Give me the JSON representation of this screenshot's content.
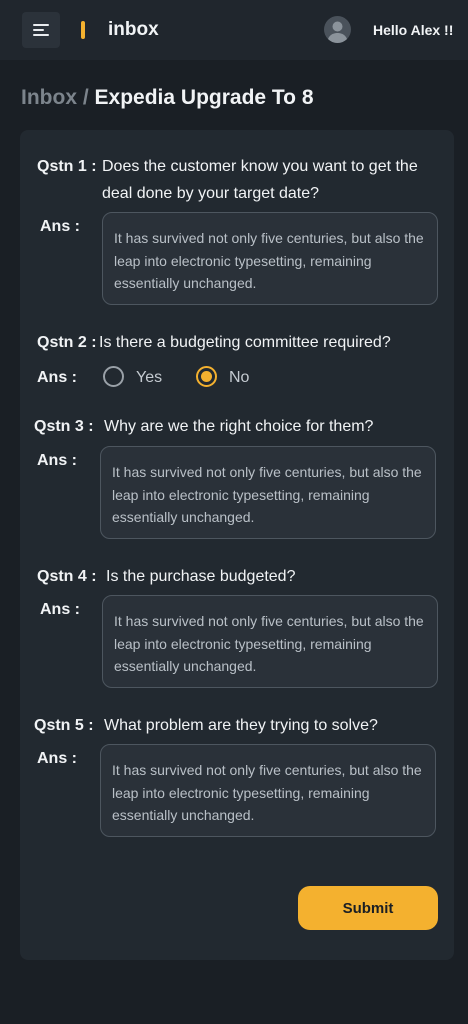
{
  "header": {
    "title": "inbox",
    "greeting": "Hello Alex !!",
    "menu_icon": "menu-icon",
    "avatar_icon": "user-avatar-icon"
  },
  "breadcrumb": {
    "root": "Inbox",
    "separator": "/",
    "current": "Expedia Upgrade To 8"
  },
  "colors": {
    "accent": "#f4b12f",
    "background": "#1a1f25",
    "card": "#222930"
  },
  "questions": [
    {
      "label": "Qstn 1 :",
      "text": "Does the customer know you want to get the deal done by your target date?",
      "answer_label": "Ans :",
      "answer": "It has survived not only five centuries, but also the leap into electronic typesetting, remaining essentially unchanged."
    },
    {
      "label": "Qstn 2 :",
      "text": "Is there a budgeting committee required?",
      "answer_label": "Ans :",
      "options": [
        "Yes",
        "No"
      ],
      "selected": "No"
    },
    {
      "label": "Qstn 3 :",
      "text": "Why are we the right choice for them?",
      "answer_label": "Ans :",
      "answer": "It has survived not only five centuries, but also the leap into electronic typesetting, remaining essentially unchanged."
    },
    {
      "label": "Qstn 4 :",
      "text": "Is the purchase budgeted?",
      "answer_label": "Ans :",
      "answer": "It has survived not only five centuries, but also the leap into electronic typesetting, remaining essentially unchanged."
    },
    {
      "label": "Qstn 5 :",
      "text": "What problem are they trying to solve?",
      "answer_label": "Ans :",
      "answer": "It has survived not only five centuries, but also the leap into electronic typesetting, remaining essentially unchanged."
    }
  ],
  "submit_label": "Submit"
}
